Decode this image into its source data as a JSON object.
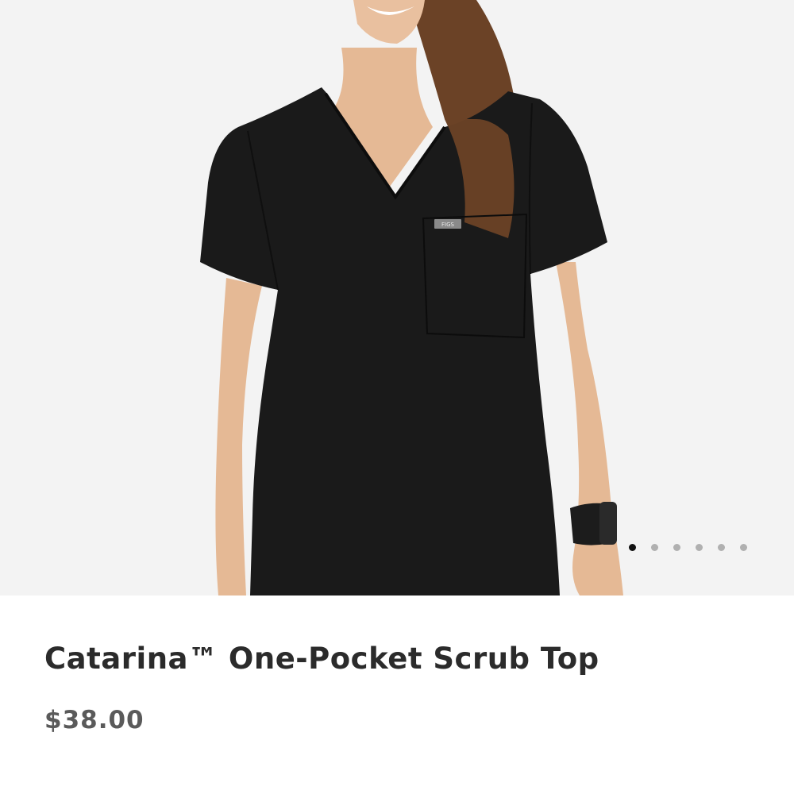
{
  "gallery": {
    "image_alt": "Model wearing black V-neck scrub top",
    "slide_count": 6,
    "active_index": 0,
    "tag_text": "FIGS"
  },
  "product": {
    "title": "Catarina™ One-Pocket Scrub Top",
    "price": "$38.00"
  },
  "colors": {
    "background": "#f3f3f3",
    "scrub": "#1a1a1a",
    "dot_active": "#111111",
    "dot_inactive": "#b0b0b0"
  }
}
